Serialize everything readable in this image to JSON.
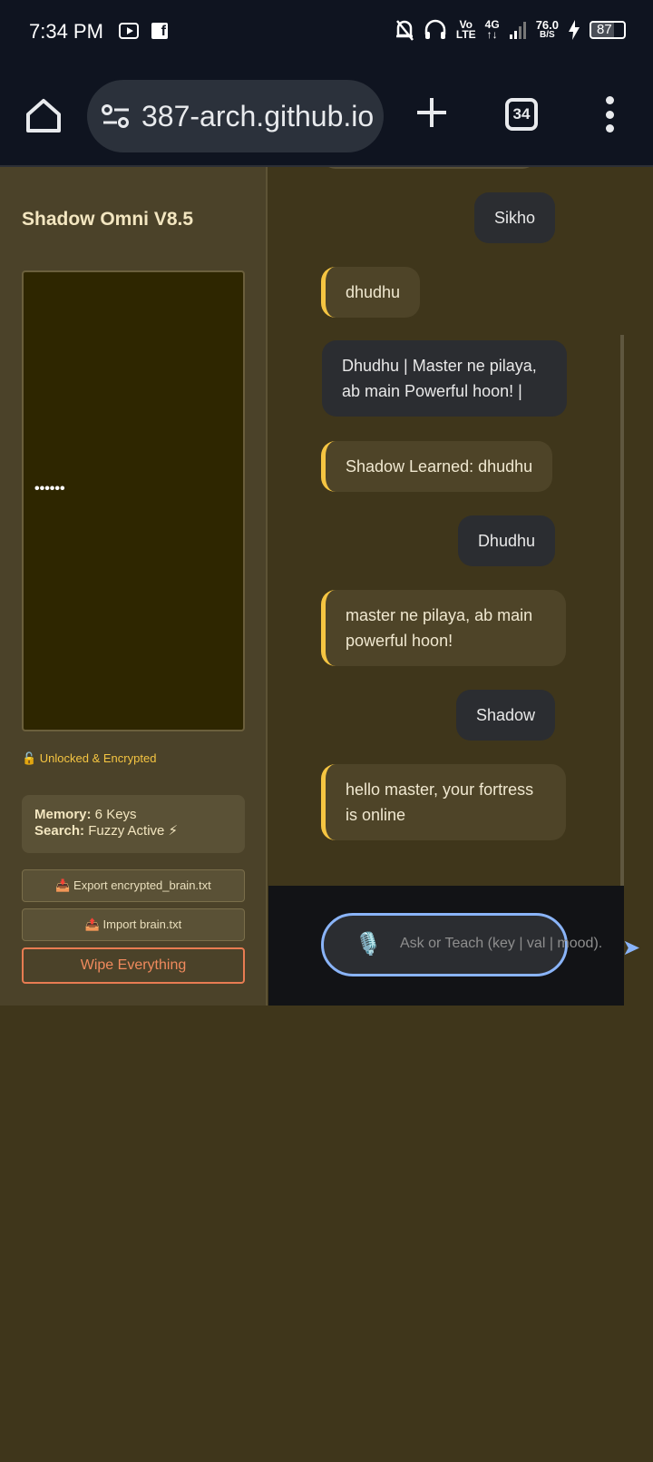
{
  "status_bar": {
    "time": "7:34 PM",
    "network_top": "Vo",
    "network_bottom": "LTE",
    "signal_top": "4G",
    "signal_bottom": "↑↓",
    "speed_top": "76.0",
    "speed_bottom": "B/S",
    "battery": "87"
  },
  "browser": {
    "url": "387-arch.github.io",
    "tab_count": "34"
  },
  "sidebar": {
    "title": "Shadow Omni V8.5",
    "viz_text": "••••••",
    "lock_status": "🔓 Unlocked & Encrypted",
    "memory_label": "Memory:",
    "memory_value": " 6 Keys",
    "search_label": "Search:",
    "search_value": " Fuzzy Active ⚡",
    "export_button": "📥 Export encrypted_brain.txt",
    "import_button": "📤 Import brain.txt",
    "wipe_button": "Wipe Everything"
  },
  "chat": {
    "messages": [
      {
        "role": "user",
        "text": "Sikho"
      },
      {
        "role": "bot",
        "text": "dhudhu"
      },
      {
        "role": "user",
        "text": "Dhudhu | Master ne pilaya, ab main Powerful hoon! |"
      },
      {
        "role": "bot",
        "text": "Shadow Learned: dhudhu"
      },
      {
        "role": "user",
        "text": "Dhudhu"
      },
      {
        "role": "bot",
        "text": "master ne pilaya, ab main powerful hoon!"
      },
      {
        "role": "user",
        "text": "Shadow"
      },
      {
        "role": "bot",
        "text": "hello master, your fortress is online"
      }
    ]
  },
  "input": {
    "placeholder": "Ask or Teach (key | val | mood)."
  },
  "colors": {
    "page_bg": "#3f361b",
    "accent_yellow": "#f5c542",
    "accent_blue": "#8ab4f8",
    "danger": "#f08a5d"
  }
}
